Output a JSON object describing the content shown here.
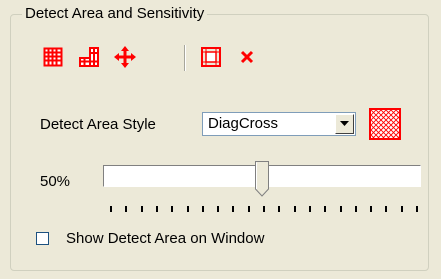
{
  "group": {
    "title": "Detect Area and Sensitivity"
  },
  "toolbar": {
    "buttons": [
      {
        "name": "grid-full-icon",
        "color": "#ff0000"
      },
      {
        "name": "grid-partial-icon",
        "color": "#ff0000"
      },
      {
        "name": "move-arrows-icon",
        "color": "#ff0000"
      },
      {
        "name": "border-grid-icon",
        "color": "#ff0000"
      },
      {
        "name": "close-x-icon",
        "color": "#ff0000"
      }
    ]
  },
  "style": {
    "label": "Detect Area Style",
    "selected": "DiagCross",
    "swatch_color": "#ff0000"
  },
  "sensitivity": {
    "label": "50%",
    "value": 0.5,
    "tick_count": 21
  },
  "show_area": {
    "label": "Show Detect Area on Window",
    "checked": false
  },
  "colors": {
    "background": "#ece9d8",
    "accent": "#ff0000"
  }
}
